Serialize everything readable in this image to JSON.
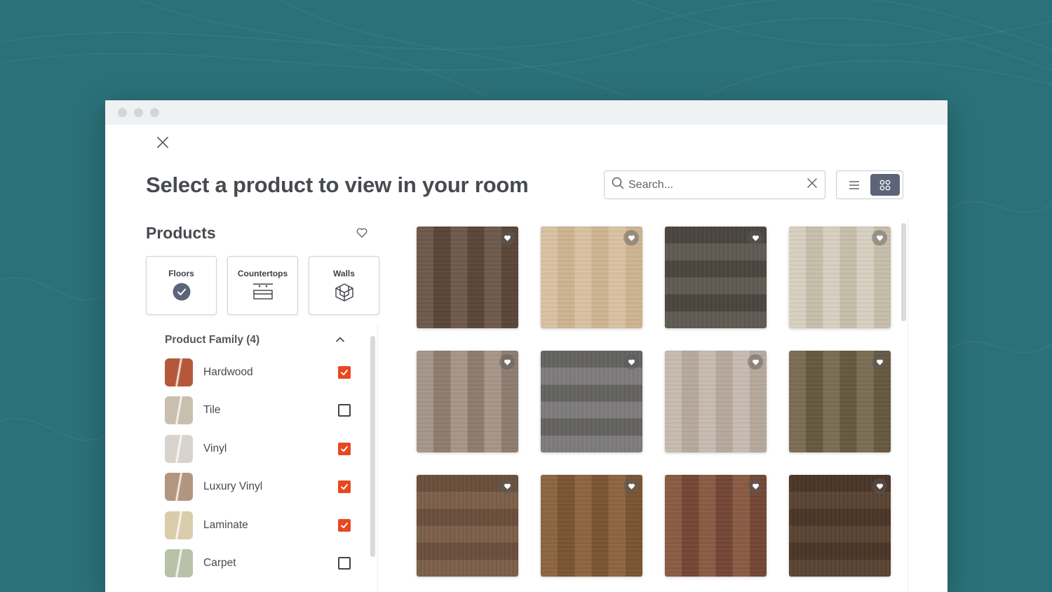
{
  "colors": {
    "background": "#2b7179",
    "accent_check": "#e8481f",
    "toggle_active": "#5c6477",
    "title_text": "#474a4f"
  },
  "page": {
    "title": "Select a product to view in your room"
  },
  "search": {
    "placeholder": "Search..."
  },
  "view_toggle": {
    "options": [
      "list-icon",
      "grid-icon"
    ],
    "active": "grid-icon"
  },
  "products": {
    "title": "Products",
    "categories": [
      {
        "label": "Floors",
        "icon": "check-circle-icon",
        "selected": true
      },
      {
        "label": "Countertops",
        "icon": "countertop-icon",
        "selected": false
      },
      {
        "label": "Walls",
        "icon": "wall-cube-icon",
        "selected": false
      }
    ]
  },
  "product_family": {
    "heading": "Product Family (4)",
    "items": [
      {
        "label": "Hardwood",
        "checked": true,
        "swatch": "#b5583a"
      },
      {
        "label": "Tile",
        "checked": false,
        "swatch": "#c9bfae"
      },
      {
        "label": "Vinyl",
        "checked": true,
        "swatch": "#d8d3cc"
      },
      {
        "label": "Luxury Vinyl",
        "checked": true,
        "swatch": "#b39680"
      },
      {
        "label": "Laminate",
        "checked": true,
        "swatch": "#d9ccaa"
      },
      {
        "label": "Carpet",
        "checked": false,
        "swatch": "#b9c1a8"
      }
    ]
  },
  "product_tiles": [
    {
      "color": "#6f5a4c",
      "shade": "#5a4538"
    },
    {
      "color": "#dcc4a3",
      "shade": "#cfb592"
    },
    {
      "color": "#5f5a52",
      "shade": "#4a453e"
    },
    {
      "color": "#d9d2c3",
      "shade": "#c9bfac"
    },
    {
      "color": "#a8978a",
      "shade": "#8f7d70"
    },
    {
      "color": "#7e7d7c",
      "shade": "#646362"
    },
    {
      "color": "#c9bdb2",
      "shade": "#b8aa9d"
    },
    {
      "color": "#7c6e55",
      "shade": "#665940"
    },
    {
      "color": "#7d5f4a",
      "shade": "#6a4e3b"
    },
    {
      "color": "#8e6540",
      "shade": "#7a5433"
    },
    {
      "color": "#8c5b43",
      "shade": "#744633"
    },
    {
      "color": "#5a4332",
      "shade": "#4a3526"
    }
  ]
}
